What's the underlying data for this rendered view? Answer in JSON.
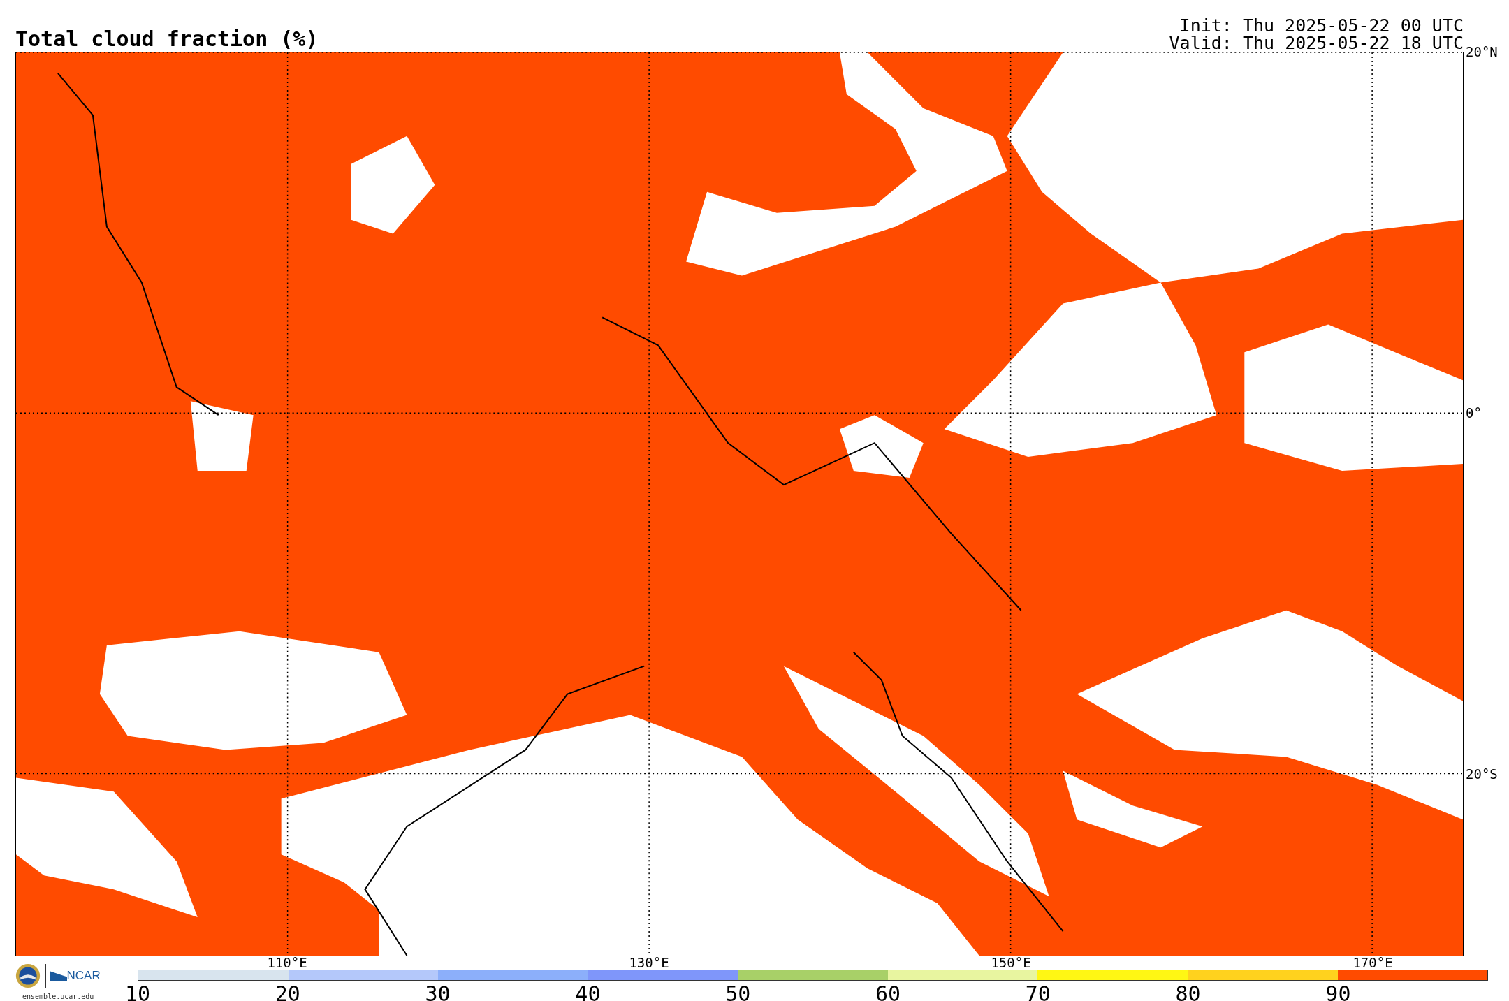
{
  "title": "Total cloud fraction (%)",
  "run_info": {
    "init": "Init: Thu 2025-05-22 00 UTC",
    "valid": "Valid: Thu 2025-05-22 18 UTC"
  },
  "map": {
    "latitude_labels": [
      "20°N",
      "0°",
      "20°S"
    ],
    "longitude_labels": [
      "110°E",
      "130°E",
      "150°E",
      "170°E"
    ]
  },
  "logos": {
    "org": "NCAR",
    "site": "ensemble.ucar.edu"
  },
  "colorbar": {
    "ticks": [
      "10",
      "20",
      "30",
      "40",
      "50",
      "60",
      "70",
      "80",
      "90"
    ],
    "bins": [
      {
        "color": "#d8e4ee"
      },
      {
        "color": "#b4c8fa"
      },
      {
        "color": "#8caffa"
      },
      {
        "color": "#7f96fa"
      },
      {
        "color": "#a8d068"
      },
      {
        "color": "#e8f5a0"
      },
      {
        "color": "#fff714"
      },
      {
        "color": "#ffd21e"
      },
      {
        "color": "#ff4b00"
      }
    ]
  }
}
